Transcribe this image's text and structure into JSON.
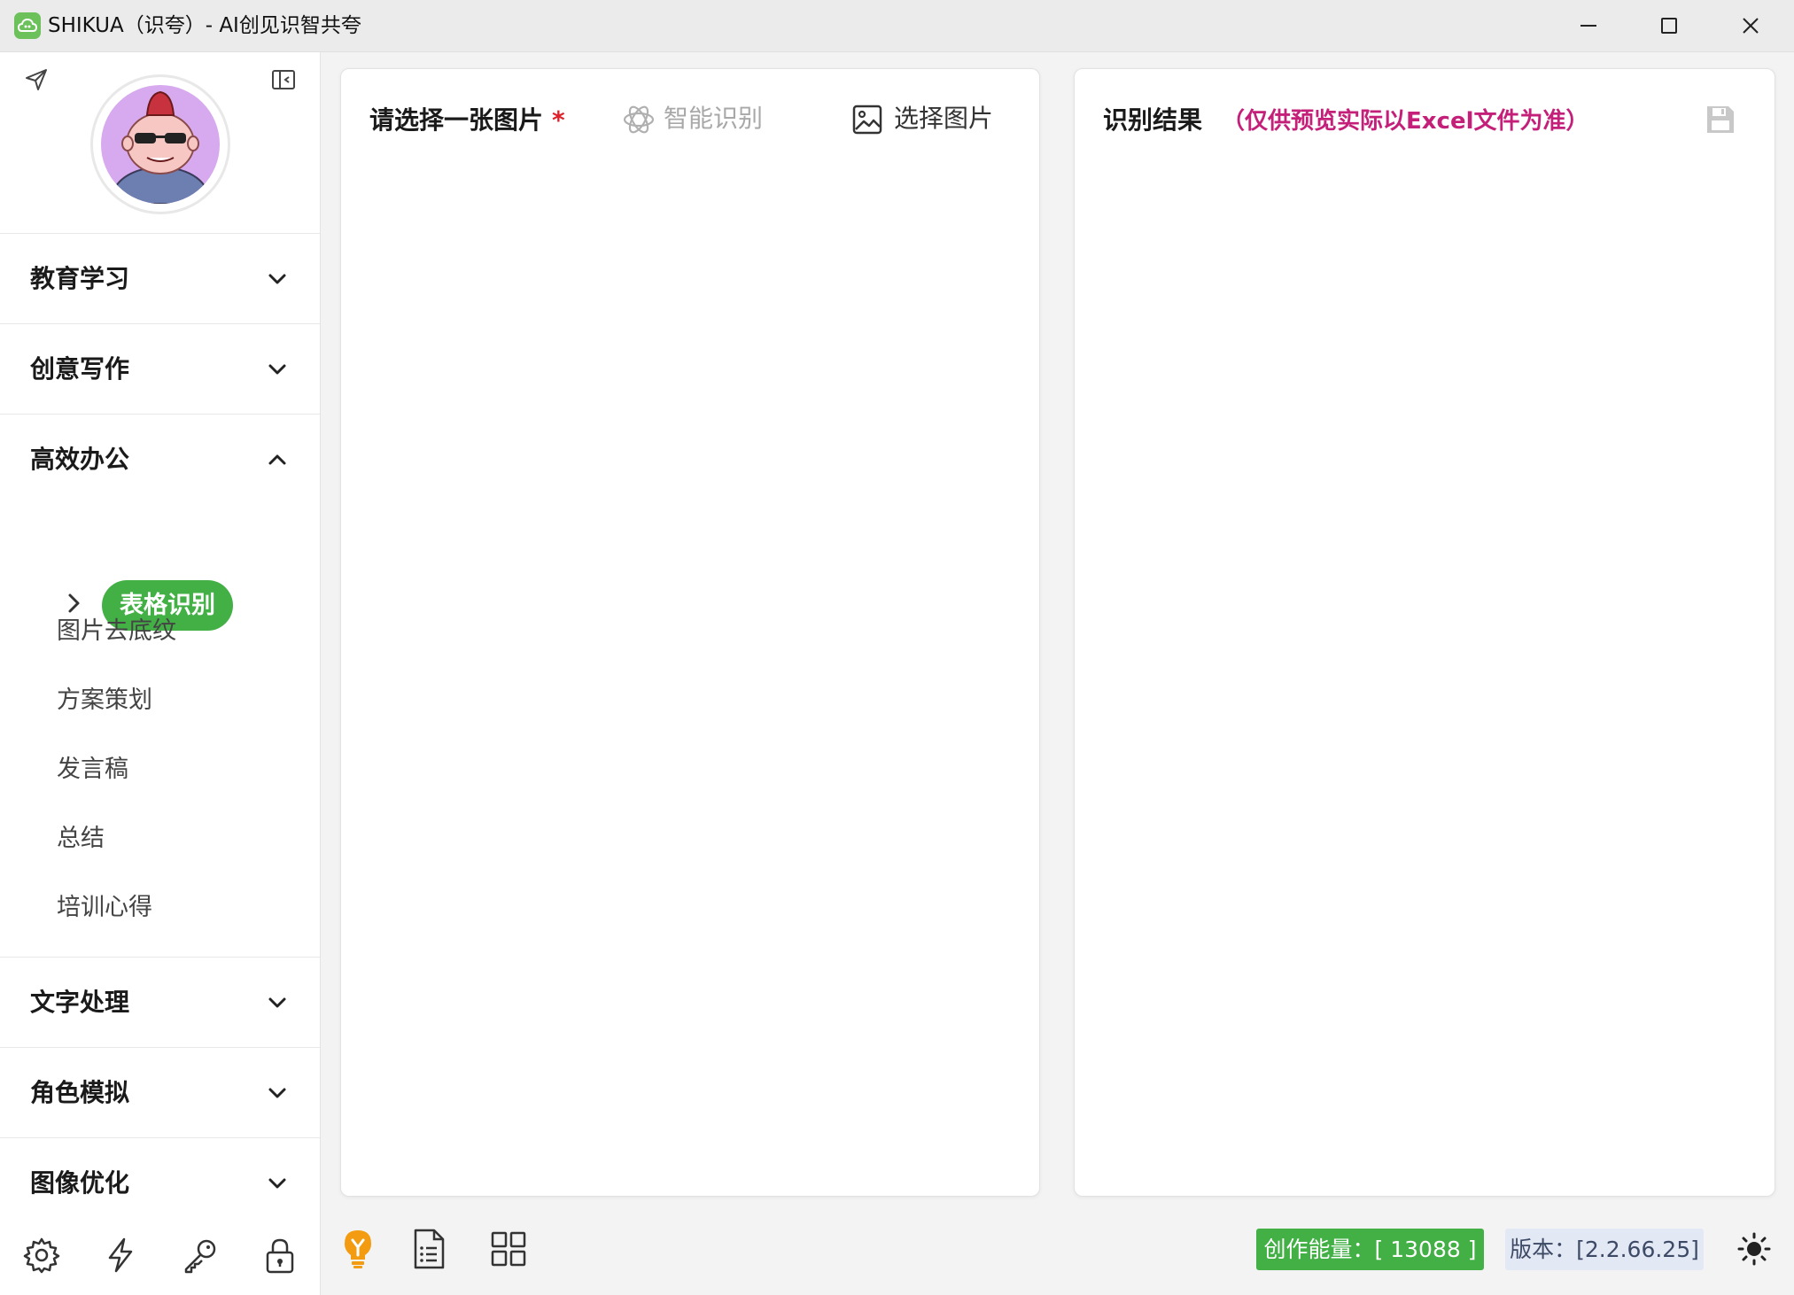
{
  "window": {
    "title": "SHIKUA（识夸）- AI创见识智共夸"
  },
  "sidebar": {
    "sections": [
      {
        "label": "教育学习",
        "expanded": false
      },
      {
        "label": "创意写作",
        "expanded": false
      },
      {
        "label": "高效办公",
        "expanded": true
      },
      {
        "label": "文字处理",
        "expanded": false
      },
      {
        "label": "角色模拟",
        "expanded": false
      },
      {
        "label": "图像优化",
        "expanded": false
      }
    ],
    "office_items": {
      "active": "表格识别",
      "items": [
        "图片去底纹",
        "方案策划",
        "发言稿",
        "总结",
        "培训心得"
      ]
    },
    "bottom_icons": [
      "gear-icon",
      "lightning-icon",
      "key-icon",
      "lock-icon"
    ]
  },
  "left_panel": {
    "title": "请选择一张图片",
    "required_mark": "*",
    "ai_button_label": "智能识别",
    "pick_button_label": "选择图片"
  },
  "right_panel": {
    "title": "识别结果",
    "note": "（仅供预览实际以Excel文件为准）"
  },
  "status_bar": {
    "energy": "创作能量：[ 13088 ]",
    "version": "版本：[2.2.66.25]"
  },
  "colors": {
    "accent_green": "#43b046",
    "note_magenta": "#c4207a",
    "required_red": "#e0202a",
    "bulb_orange": "#f39c12"
  }
}
